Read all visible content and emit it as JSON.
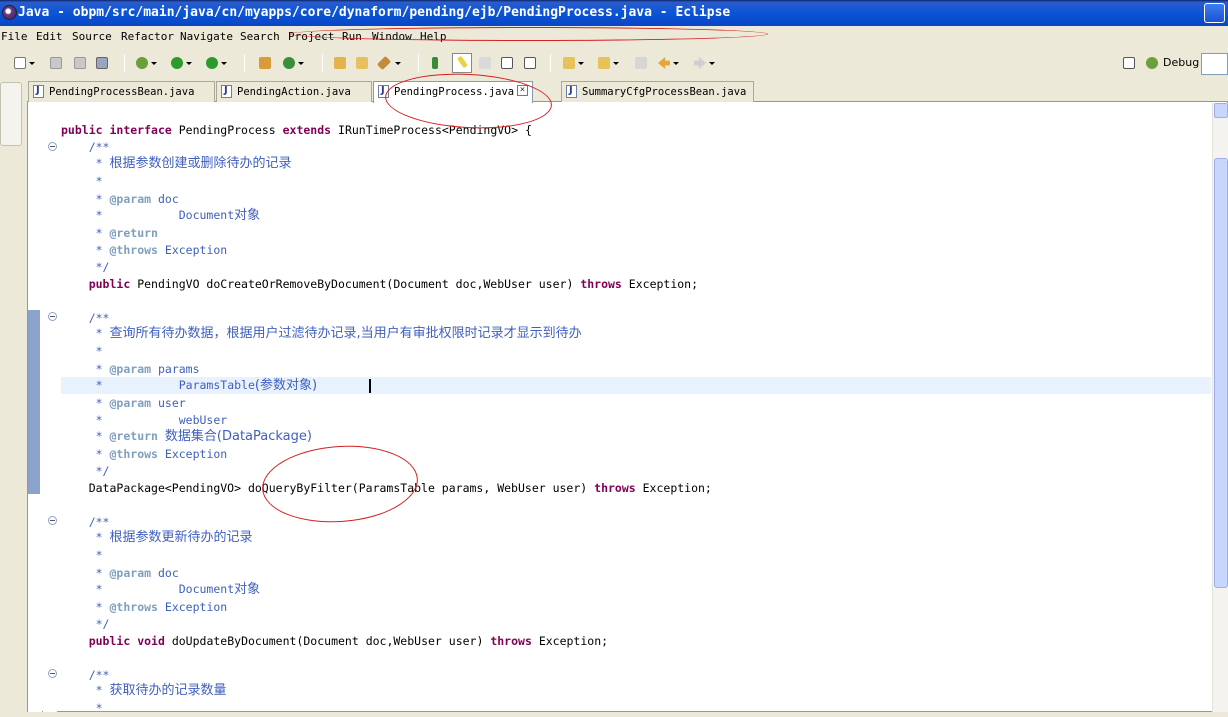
{
  "window": {
    "title": "Java - obpm/src/main/java/cn/myapps/core/dynaform/pending/ejb/PendingProcess.java - Eclipse"
  },
  "menu": [
    "File",
    "Edit",
    "Source",
    "Refactor",
    "Navigate",
    "Search",
    "Project",
    "Run",
    "Window",
    "Help"
  ],
  "toolbar": {
    "icons": [
      "new-icon",
      "save-icon",
      "save-all-icon",
      "print-icon",
      "debug-icon",
      "run-icon",
      "external-tools-icon",
      "new-package-icon",
      "new-class-icon",
      "open-type-icon",
      "open-folder-icon",
      "search-icon",
      "toggle-mark-occurrences-icon",
      "highlight-icon",
      "show-whitespace-icon",
      "next-annotation-icon",
      "previous-annotation-icon",
      "back-icon",
      "forward-icon"
    ],
    "perspective_debug": "Debug"
  },
  "tabs": [
    {
      "label": "PendingProcessBean.java",
      "active": false
    },
    {
      "label": "PendingAction.java",
      "active": false
    },
    {
      "label": "PendingProcess.java",
      "active": true
    },
    {
      "label": "SummaryCfgProcessBean.java",
      "active": false
    }
  ],
  "code": {
    "l1_kw1": "public",
    "l1_kw2": "interface",
    "l1_name": "PendingProcess",
    "l1_kw3": "extends",
    "l1_rest": "IRunTimeProcess<PendingVO> {",
    "c1_open": "/**",
    "c1_desc": "根据参数创建或删除待办的记录",
    "star": "*",
    "c1_param": "@param",
    "c1_param_name": "doc",
    "c1_param_desc_en": "Document",
    "c1_param_desc_cn": "对象",
    "c1_return": "@return",
    "c1_throws": "@throws",
    "c1_throws_name": "Exception",
    "c_close": "*/",
    "m1_kw": "public",
    "m1_rest": "PendingVO doCreateOrRemoveByDocument(Document doc,WebUser user)",
    "m1_throws": "throws",
    "m1_end": "Exception;",
    "c2_open": "/**",
    "c2_desc": "查询所有待办数据，根据用户过滤待办记录,当用户有审批权限时记录才显示到待办",
    "c2_param1": "@param",
    "c2_param1_name": "params",
    "c2_param1_desc_en": "ParamsTable",
    "c2_param1_desc_cn": "(参数对象)",
    "c2_param2": "@param",
    "c2_param2_name": "user",
    "c2_param2_desc": "webUser",
    "c2_return": "@return",
    "c2_return_desc": "数据集合(DataPackage)",
    "c2_throws": "@throws",
    "c2_throws_name": "Exception",
    "m2_rest": "DataPackage<PendingVO> doQueryByFilter(ParamsTable params, WebUser user)",
    "m2_throws": "throws",
    "m2_end": "Exception;",
    "c3_open": "/**",
    "c3_desc": "根据参数更新待办的记录",
    "c3_param": "@param",
    "c3_param_name": "doc",
    "c3_param_desc_en": "Document",
    "c3_param_desc_cn": "对象",
    "c3_throws": "@throws",
    "c3_throws_name": "Exception",
    "m3_kw1": "public",
    "m3_kw2": "void",
    "m3_rest": "doUpdateByDocument(Document doc,WebUser user)",
    "m3_throws": "throws",
    "m3_end": "Exception;",
    "c4_open": "/**",
    "c4_desc": "获取待办的记录数量"
  },
  "colors": {
    "keyword": "#7f0055",
    "javadoc": "#3f5fbf",
    "javadoc_tag": "#7f9fbf",
    "annotation_circle": "#d42020",
    "titlebar": "#0b55d8"
  }
}
